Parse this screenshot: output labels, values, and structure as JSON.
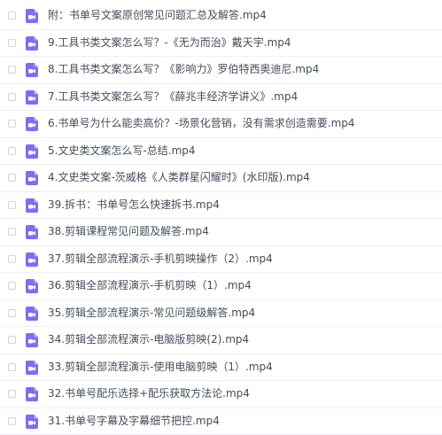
{
  "file_icon": "video-file-icon",
  "accent_color": "#7c6df2",
  "files": [
    {
      "name": "附：书单号文案原创常见问题汇总及解答.mp4"
    },
    {
      "name": "9.工具书类文案怎么写？-《无为而治》戴天宇.mp4"
    },
    {
      "name": "8.工具书类文案怎么写？《影响力》罗伯特西奥迪尼.mp4"
    },
    {
      "name": "7.工具书类文案怎么写？《薛兆丰经济学讲义》.mp4"
    },
    {
      "name": "6.书单号为什么能卖高价？-场景化营销，没有需求创造需要.mp4"
    },
    {
      "name": "5.文史类文案怎么写-总结.mp4"
    },
    {
      "name": "4.文史类文案-茨威格《人类群星闪耀时》(水印版).mp4"
    },
    {
      "name": "39.拆书：书单号怎么快速拆书.mp4"
    },
    {
      "name": "38.剪辑课程常见问题及解答.mp4"
    },
    {
      "name": "37.剪辑全部流程演示-手机剪映操作（2）.mp4"
    },
    {
      "name": "36.剪辑全部流程演示-手机剪映（1）.mp4"
    },
    {
      "name": "35.剪辑全部流程演示-常见问题级解答.mp4"
    },
    {
      "name": "34.剪辑全部流程演示-电脑版剪映(2).mp4"
    },
    {
      "name": "33.剪辑全部流程演示-使用电脑剪映（1）.mp4"
    },
    {
      "name": "32.书单号配乐选择+配乐获取方法论.mp4"
    },
    {
      "name": "31.书单号字幕及字幕细节把控.mp4"
    }
  ]
}
